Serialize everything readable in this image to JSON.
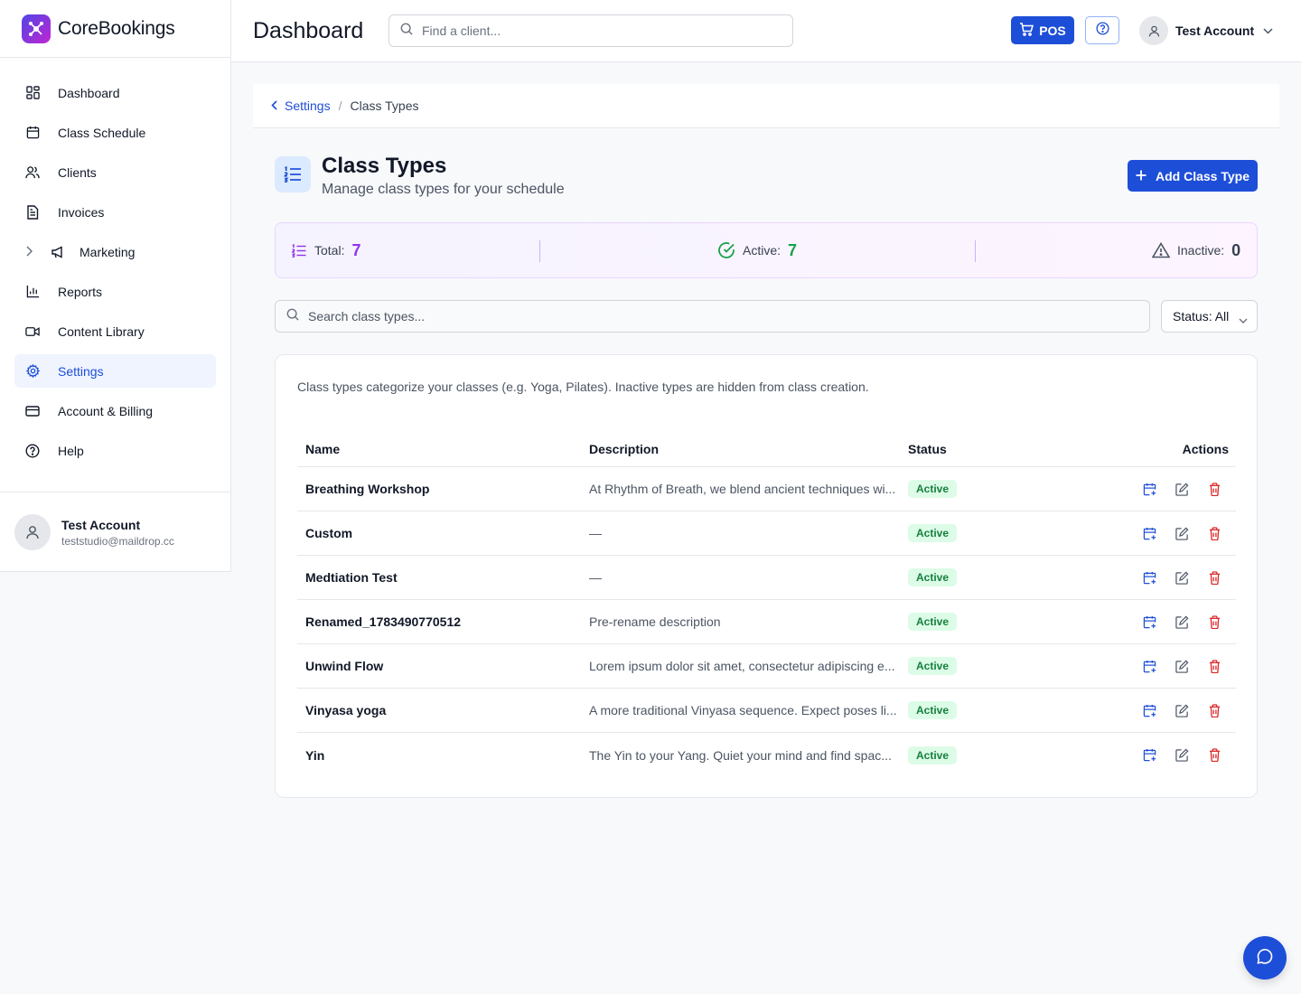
{
  "brand": {
    "name": "CoreBookings",
    "accent": "#1d4ed8"
  },
  "sidebar": {
    "items": [
      {
        "label": "Dashboard",
        "icon": "dashboard-icon"
      },
      {
        "label": "Class Schedule",
        "icon": "calendar-icon"
      },
      {
        "label": "Clients",
        "icon": "users-icon"
      },
      {
        "label": "Invoices",
        "icon": "invoice-icon"
      },
      {
        "label": "Marketing",
        "icon": "megaphone-icon"
      },
      {
        "label": "Reports",
        "icon": "bar-chart-icon"
      },
      {
        "label": "Content Library",
        "icon": "video-icon"
      },
      {
        "label": "Settings",
        "icon": "gear-icon"
      },
      {
        "label": "Account & Billing",
        "icon": "credit-card-icon"
      },
      {
        "label": "Help",
        "icon": "help-circle-icon"
      }
    ],
    "user": {
      "name": "Test Account",
      "email": "teststudio@maildrop.cc"
    }
  },
  "header": {
    "title": "Dashboard",
    "search_placeholder": "Find a client...",
    "pos_label": "POS",
    "account_name": "Test Account"
  },
  "breadcrumb": {
    "parent": "Settings",
    "current": "Class Types"
  },
  "page": {
    "title": "Class Types",
    "subtitle": "Manage class types for your schedule",
    "add_button": "Add Class Type"
  },
  "stats": {
    "total_label": "Total:",
    "total_value": "7",
    "active_label": "Active:",
    "active_value": "7",
    "inactive_label": "Inactive:",
    "inactive_value": "0"
  },
  "filters": {
    "search_placeholder": "Search class types...",
    "status_value": "Status: All"
  },
  "card": {
    "note": "Class types categorize your classes (e.g. Yoga, Pilates). Inactive types are hidden from class creation."
  },
  "table": {
    "columns": {
      "name": "Name",
      "description": "Description",
      "status": "Status",
      "actions": "Actions"
    },
    "rows": [
      {
        "name": "Breathing Workshop",
        "description": "At Rhythm of Breath, we blend ancient techniques wi...",
        "status": "Active"
      },
      {
        "name": "Custom",
        "description": "—",
        "status": "Active"
      },
      {
        "name": "Medtiation Test",
        "description": "—",
        "status": "Active"
      },
      {
        "name": "Renamed_1783490770512",
        "description": "Pre-rename description",
        "status": "Active"
      },
      {
        "name": "Unwind Flow",
        "description": "Lorem ipsum dolor sit amet, consectetur adipiscing e...",
        "status": "Active"
      },
      {
        "name": "Vinyasa yoga",
        "description": "A more traditional Vinyasa sequence. Expect poses li...",
        "status": "Active"
      },
      {
        "name": "Yin",
        "description": "The Yin to your Yang. Quiet your mind and find spac...",
        "status": "Active"
      }
    ]
  }
}
